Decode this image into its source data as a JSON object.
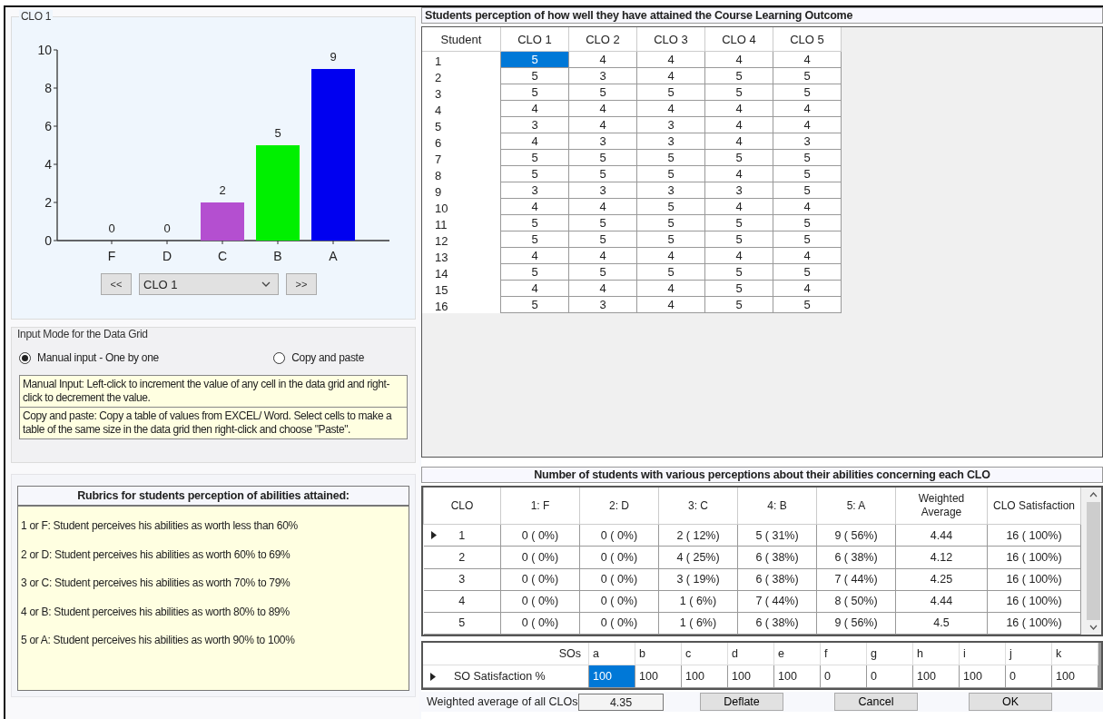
{
  "chart_panel": {
    "title": "CLO 1",
    "chart_data": {
      "type": "bar",
      "categories": [
        "F",
        "D",
        "C",
        "B",
        "A"
      ],
      "series": [
        {
          "colors": [
            null,
            null,
            "#b44fd0",
            "#00f000",
            "#0000f0"
          ],
          "values": [
            0,
            0,
            2,
            5,
            9
          ]
        }
      ],
      "ylim": [
        0,
        10
      ],
      "yticks": [
        0,
        2,
        4,
        6,
        8,
        10
      ],
      "data_labels": true
    },
    "prev_button": "<<",
    "selector": {
      "value": "CLO 1"
    },
    "next_button": ">>"
  },
  "input_mode": {
    "title": "Input Mode for the Data Grid",
    "options": [
      {
        "label": "Manual input - One by one",
        "selected": true
      },
      {
        "label": "Copy and paste",
        "selected": false
      }
    ],
    "help": [
      "Manual Input: Left-click to increment the value of any cell in the data grid and  right-click to decrement the value.",
      "Copy and paste: Copy a table of values from EXCEL/ Word. Select cells to make a table of the same size  in the data grid  then right-click and choose  \"Paste\"."
    ]
  },
  "rubrics": {
    "title": "Rubrics for students perception of abilities attained:",
    "items": [
      "1 or F: Student perceives his abilities as worth less than 60%",
      "2 or D: Student perceives his abilities as worth 60% to 69%",
      "3 or C: Student perceives his abilities as worth 70% to 79%",
      "4 or B: Student perceives his abilities as worth 80% to 89%",
      "5 or A: Student perceives his abilities as worth 90% to 100%"
    ]
  },
  "perception_table": {
    "title": "Students perception of how well they have attained the Course Learning Outcome",
    "columns": [
      "Student",
      "CLO 1",
      "CLO 2",
      "CLO 3",
      "CLO 4",
      "CLO 5"
    ],
    "rows": [
      {
        "cells": [
          {
            "value": "1",
            "selected": false
          },
          {
            "value": "5",
            "selected": true
          },
          {
            "value": "4",
            "selected": false
          },
          {
            "value": "4",
            "selected": false
          },
          {
            "value": "4",
            "selected": false
          },
          {
            "value": "4",
            "selected": false
          }
        ]
      },
      {
        "cells": [
          {
            "value": "2",
            "selected": false
          },
          {
            "value": "5",
            "selected": false
          },
          {
            "value": "3",
            "selected": false
          },
          {
            "value": "4",
            "selected": false
          },
          {
            "value": "5",
            "selected": false
          },
          {
            "value": "5",
            "selected": false
          }
        ]
      },
      {
        "cells": [
          {
            "value": "3",
            "selected": false
          },
          {
            "value": "5",
            "selected": false
          },
          {
            "value": "5",
            "selected": false
          },
          {
            "value": "5",
            "selected": false
          },
          {
            "value": "5",
            "selected": false
          },
          {
            "value": "5",
            "selected": false
          }
        ]
      },
      {
        "cells": [
          {
            "value": "4",
            "selected": false
          },
          {
            "value": "4",
            "selected": false
          },
          {
            "value": "4",
            "selected": false
          },
          {
            "value": "4",
            "selected": false
          },
          {
            "value": "4",
            "selected": false
          },
          {
            "value": "4",
            "selected": false
          }
        ]
      },
      {
        "cells": [
          {
            "value": "5",
            "selected": false
          },
          {
            "value": "3",
            "selected": false
          },
          {
            "value": "4",
            "selected": false
          },
          {
            "value": "3",
            "selected": false
          },
          {
            "value": "4",
            "selected": false
          },
          {
            "value": "4",
            "selected": false
          }
        ]
      },
      {
        "cells": [
          {
            "value": "6",
            "selected": false
          },
          {
            "value": "4",
            "selected": false
          },
          {
            "value": "3",
            "selected": false
          },
          {
            "value": "3",
            "selected": false
          },
          {
            "value": "4",
            "selected": false
          },
          {
            "value": "3",
            "selected": false
          }
        ]
      },
      {
        "cells": [
          {
            "value": "7",
            "selected": false
          },
          {
            "value": "5",
            "selected": false
          },
          {
            "value": "5",
            "selected": false
          },
          {
            "value": "5",
            "selected": false
          },
          {
            "value": "5",
            "selected": false
          },
          {
            "value": "5",
            "selected": false
          }
        ]
      },
      {
        "cells": [
          {
            "value": "8",
            "selected": false
          },
          {
            "value": "5",
            "selected": false
          },
          {
            "value": "5",
            "selected": false
          },
          {
            "value": "5",
            "selected": false
          },
          {
            "value": "4",
            "selected": false
          },
          {
            "value": "5",
            "selected": false
          }
        ]
      },
      {
        "cells": [
          {
            "value": "9",
            "selected": false
          },
          {
            "value": "3",
            "selected": false
          },
          {
            "value": "3",
            "selected": false
          },
          {
            "value": "3",
            "selected": false
          },
          {
            "value": "3",
            "selected": false
          },
          {
            "value": "5",
            "selected": false
          }
        ]
      },
      {
        "cells": [
          {
            "value": "10",
            "selected": false
          },
          {
            "value": "4",
            "selected": false
          },
          {
            "value": "4",
            "selected": false
          },
          {
            "value": "5",
            "selected": false
          },
          {
            "value": "4",
            "selected": false
          },
          {
            "value": "4",
            "selected": false
          }
        ]
      },
      {
        "cells": [
          {
            "value": "11",
            "selected": false
          },
          {
            "value": "5",
            "selected": false
          },
          {
            "value": "5",
            "selected": false
          },
          {
            "value": "5",
            "selected": false
          },
          {
            "value": "5",
            "selected": false
          },
          {
            "value": "5",
            "selected": false
          }
        ]
      },
      {
        "cells": [
          {
            "value": "12",
            "selected": false
          },
          {
            "value": "5",
            "selected": false
          },
          {
            "value": "5",
            "selected": false
          },
          {
            "value": "5",
            "selected": false
          },
          {
            "value": "5",
            "selected": false
          },
          {
            "value": "5",
            "selected": false
          }
        ]
      },
      {
        "cells": [
          {
            "value": "13",
            "selected": false
          },
          {
            "value": "4",
            "selected": false
          },
          {
            "value": "4",
            "selected": false
          },
          {
            "value": "4",
            "selected": false
          },
          {
            "value": "4",
            "selected": false
          },
          {
            "value": "4",
            "selected": false
          }
        ]
      },
      {
        "cells": [
          {
            "value": "14",
            "selected": false
          },
          {
            "value": "5",
            "selected": false
          },
          {
            "value": "5",
            "selected": false
          },
          {
            "value": "5",
            "selected": false
          },
          {
            "value": "5",
            "selected": false
          },
          {
            "value": "5",
            "selected": false
          }
        ]
      },
      {
        "cells": [
          {
            "value": "15",
            "selected": false
          },
          {
            "value": "4",
            "selected": false
          },
          {
            "value": "4",
            "selected": false
          },
          {
            "value": "4",
            "selected": false
          },
          {
            "value": "5",
            "selected": false
          },
          {
            "value": "4",
            "selected": false
          }
        ]
      },
      {
        "cells": [
          {
            "value": "16",
            "selected": false
          },
          {
            "value": "5",
            "selected": false
          },
          {
            "value": "3",
            "selected": false
          },
          {
            "value": "4",
            "selected": false
          },
          {
            "value": "5",
            "selected": false
          },
          {
            "value": "5",
            "selected": false
          }
        ]
      }
    ]
  },
  "summary_table": {
    "title": "Number of students with various perceptions about their abilities concerning each CLO",
    "columns": [
      "CLO",
      "1: F",
      "2: D",
      "3: C",
      "4: B",
      "5: A",
      "Weighted Average",
      "CLO Satisfaction"
    ],
    "rows": [
      {
        "current": true,
        "cells": [
          "1",
          "0 ( 0%)",
          "0 ( 0%)",
          "2 ( 12%)",
          "5 ( 31%)",
          "9 ( 56%)",
          "4.44",
          "16 ( 100%)"
        ]
      },
      {
        "current": false,
        "cells": [
          "2",
          "0 ( 0%)",
          "0 ( 0%)",
          "4 ( 25%)",
          "6 ( 38%)",
          "6 ( 38%)",
          "4.12",
          "16 ( 100%)"
        ]
      },
      {
        "current": false,
        "cells": [
          "3",
          "0 ( 0%)",
          "0 ( 0%)",
          "3 ( 19%)",
          "6 ( 38%)",
          "7 ( 44%)",
          "4.25",
          "16 ( 100%)"
        ]
      },
      {
        "current": false,
        "cells": [
          "4",
          "0 ( 0%)",
          "0 ( 0%)",
          "1 ( 6%)",
          "7 ( 44%)",
          "8 ( 50%)",
          "4.44",
          "16 ( 100%)"
        ]
      },
      {
        "current": false,
        "cells": [
          "5",
          "0 ( 0%)",
          "0 ( 0%)",
          "1 ( 6%)",
          "6 ( 38%)",
          "9 ( 56%)",
          "4.5",
          "16 ( 100%)"
        ]
      }
    ]
  },
  "so_table": {
    "header_label": "SOs",
    "row_label": "SO Satisfaction %",
    "current": true,
    "items": [
      {
        "label": "a",
        "value": "100",
        "selected": true
      },
      {
        "label": "b",
        "value": "100",
        "selected": false
      },
      {
        "label": "c",
        "value": "100",
        "selected": false
      },
      {
        "label": "d",
        "value": "100",
        "selected": false
      },
      {
        "label": "e",
        "value": "100",
        "selected": false
      },
      {
        "label": "f",
        "value": "0",
        "selected": false
      },
      {
        "label": "g",
        "value": "0",
        "selected": false
      },
      {
        "label": "h",
        "value": "100",
        "selected": false
      },
      {
        "label": "i",
        "value": "100",
        "selected": false
      },
      {
        "label": "j",
        "value": "0",
        "selected": false
      },
      {
        "label": "k",
        "value": "100",
        "selected": false
      }
    ]
  },
  "footer": {
    "average_label": "Weighted average of all CLOs",
    "average_value": "4.35",
    "buttons": [
      "Deflate",
      "Cancel",
      "OK"
    ]
  }
}
